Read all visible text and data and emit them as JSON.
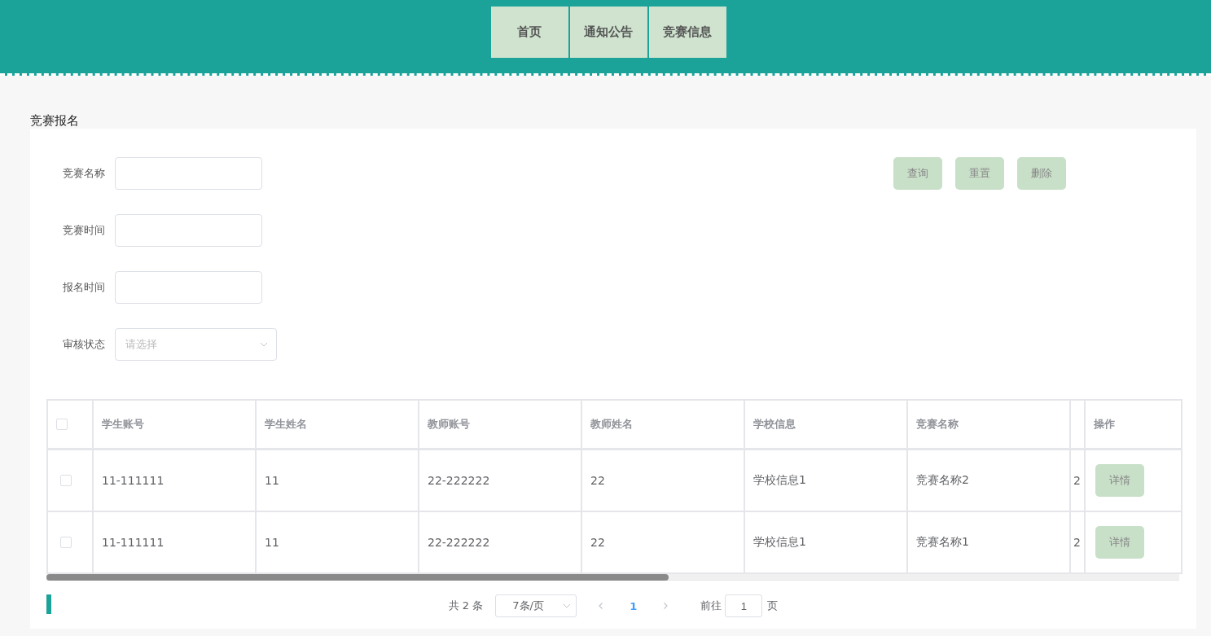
{
  "nav": [
    {
      "label": "首页",
      "selected": false
    },
    {
      "label": "通知公告",
      "selected": false
    },
    {
      "label": "竞赛信息",
      "selected": false
    }
  ],
  "page_title": "竞赛报名",
  "filters": [
    {
      "kind": "input",
      "label": "竞赛名称"
    },
    {
      "kind": "input",
      "label": "竞赛时间"
    },
    {
      "kind": "input",
      "label": "报名时间"
    },
    {
      "kind": "select",
      "label": "审核状态",
      "placeholder": "请选择"
    }
  ],
  "actions": [
    "查询",
    "重置",
    "删除"
  ],
  "table": {
    "select_all_checked": false,
    "columns": [
      "学生账号",
      "学生姓名",
      "教师账号",
      "教师姓名",
      "学校信息",
      "竞赛名称",
      "",
      "操作"
    ],
    "rows": [
      {
        "checked": false,
        "cells": [
          "11-111111",
          "11",
          "22-222222",
          "22",
          "学校信息1",
          "竞赛名称2",
          "2"
        ],
        "action": "详情"
      },
      {
        "checked": false,
        "cells": [
          "11-111111",
          "11",
          "22-222222",
          "22",
          "学校信息1",
          "竞赛名称1",
          "2"
        ],
        "action": "详情"
      }
    ]
  },
  "pagination": {
    "total": "共 2 条",
    "page_size": "7条/页",
    "current_page": "1",
    "goto_label": "前往",
    "goto_value": "1",
    "goto_suffix": "页"
  }
}
